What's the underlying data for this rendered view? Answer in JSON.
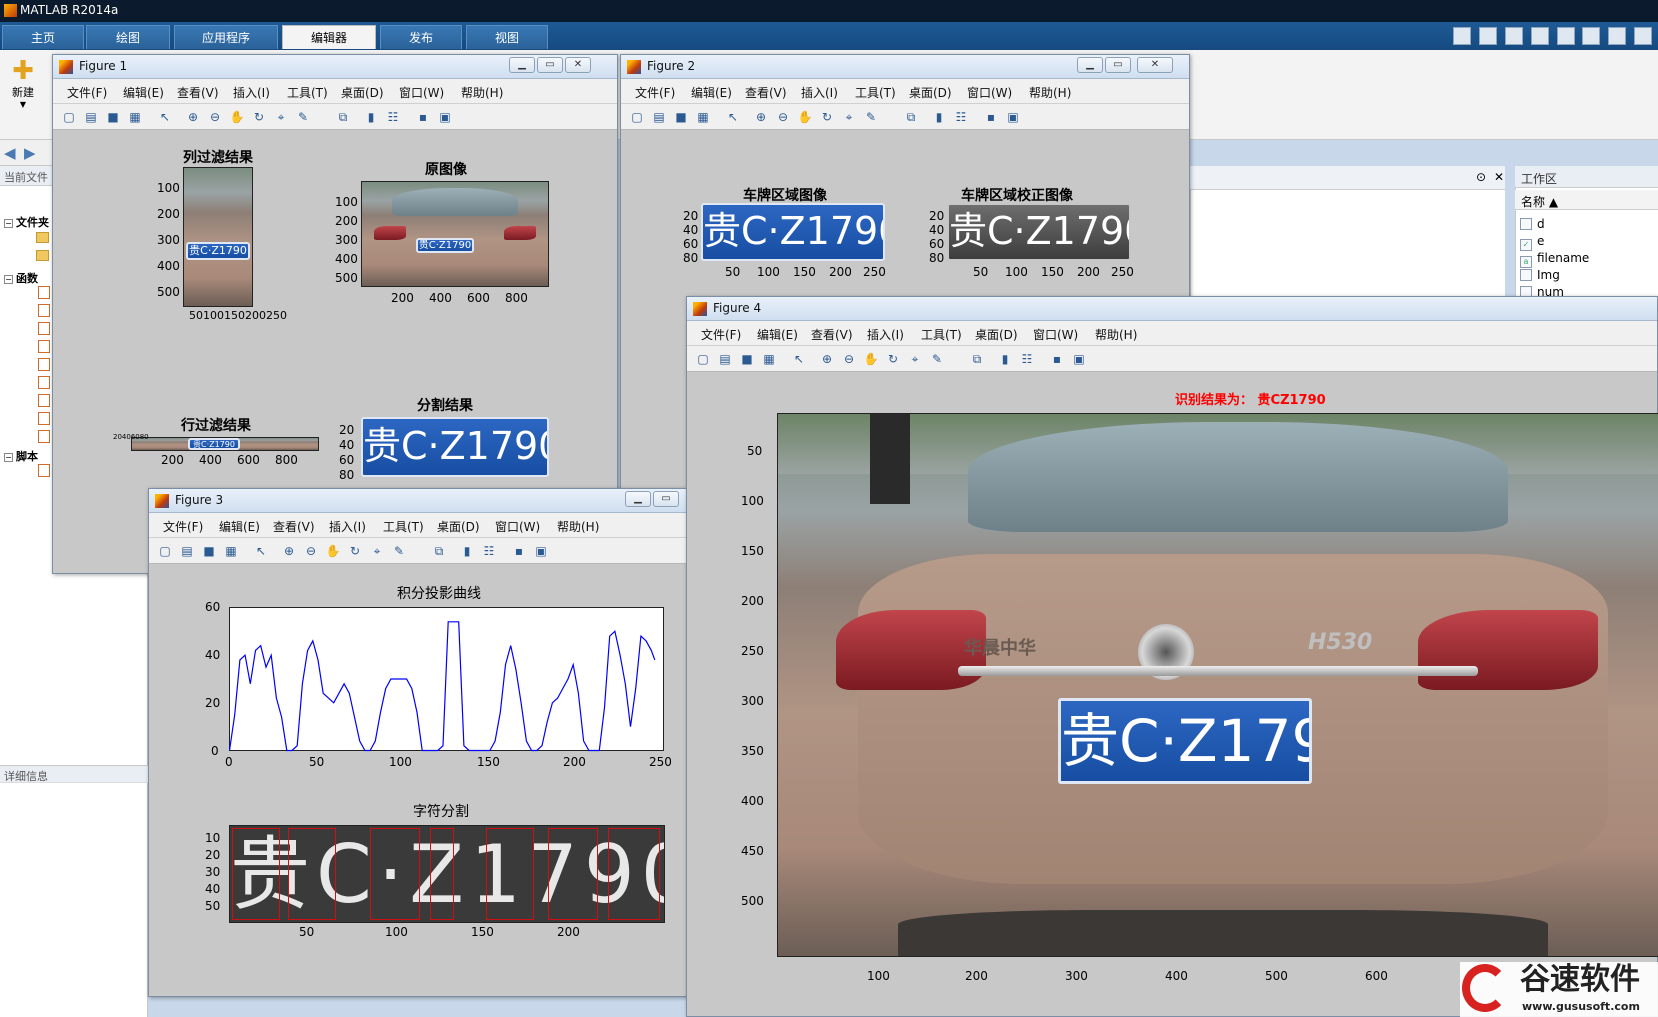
{
  "app": {
    "title": "MATLAB R2014a",
    "tabs": [
      "主页",
      "绘图",
      "应用程序",
      "编辑器",
      "发布",
      "视图"
    ],
    "active_tab": "编辑器",
    "new_label": "新建"
  },
  "left_panel": {
    "current_folder": "当前文件",
    "folder_node": "文件夹",
    "functions_node": "函数",
    "scripts_node": "脚本",
    "details": "详细信息"
  },
  "workspace": {
    "title": "工作区",
    "column": "名称 ▲",
    "vars": [
      "d",
      "e",
      "filename",
      "Img",
      "num"
    ]
  },
  "figure_menu": [
    "文件(F)",
    "编辑(E)",
    "查看(V)",
    "插入(I)",
    "工具(T)",
    "桌面(D)",
    "窗口(W)",
    "帮助(H)"
  ],
  "fig1": {
    "title": "Figure 1",
    "ax_col_title": "列过滤结果",
    "ax_col_yticks": [
      "100",
      "200",
      "300",
      "400",
      "500"
    ],
    "ax_col_xticks": "50100150200250",
    "ax_orig_title": "原图像",
    "ax_orig_yticks": [
      "100",
      "200",
      "300",
      "400",
      "500"
    ],
    "ax_orig_xticks": [
      "200",
      "400",
      "600",
      "800"
    ],
    "ax_row_title": "行过滤结果",
    "ax_row_yticks": "20406080",
    "ax_row_xticks": [
      "200",
      "400",
      "600",
      "800"
    ],
    "ax_seg_title": "分割结果",
    "ax_seg_yticks": [
      "20",
      "40",
      "60",
      "80"
    ]
  },
  "fig2": {
    "title": "Figure 2",
    "ax_plate_title": "车牌区域图像",
    "ax_corr_title": "车牌区域校正图像",
    "yticks": [
      "20",
      "40",
      "60",
      "80"
    ],
    "xticks": [
      "50",
      "100",
      "150",
      "200",
      "250"
    ]
  },
  "fig3": {
    "title": "Figure 3",
    "curve_title": "积分投影曲线",
    "curve_yticks": [
      "60",
      "40",
      "20",
      "0"
    ],
    "curve_xticks": [
      "0",
      "50",
      "100",
      "150",
      "200",
      "250"
    ],
    "seg_title": "字符分割",
    "seg_yticks": [
      "10",
      "20",
      "30",
      "40",
      "50"
    ],
    "seg_xticks": [
      "50",
      "100",
      "150",
      "200"
    ]
  },
  "fig4": {
    "title": "Figure 4",
    "result": "识别结果为： 贵CZ1790",
    "yticks": [
      "50",
      "100",
      "150",
      "200",
      "250",
      "300",
      "350",
      "400",
      "450",
      "500"
    ],
    "xticks": [
      "100",
      "200",
      "300",
      "400",
      "500",
      "600"
    ]
  },
  "plate_text": "贵C·Z1790",
  "car_brand_left": "华晨中华",
  "car_brand_right": "H530",
  "watermark": {
    "name": "谷速软件",
    "url": "www.gususoft.com"
  },
  "colors": {
    "ribbon": "#1e5a95",
    "plate_blue": "#1f5bb5",
    "curve": "#0000ff",
    "result_text": "#ff0000",
    "watermark_red": "#d7221f"
  },
  "chart_data": {
    "type": "line",
    "title": "积分投影曲线",
    "xlim": [
      0,
      250
    ],
    "ylim": [
      0,
      60
    ],
    "series": [
      {
        "values": [
          [
            0,
            0
          ],
          [
            3,
            15
          ],
          [
            6,
            38
          ],
          [
            9,
            40
          ],
          [
            12,
            28
          ],
          [
            15,
            42
          ],
          [
            18,
            44
          ],
          [
            21,
            35
          ],
          [
            24,
            40
          ],
          [
            27,
            22
          ],
          [
            30,
            14
          ],
          [
            33,
            0
          ],
          [
            36,
            0
          ],
          [
            39,
            2
          ],
          [
            42,
            28
          ],
          [
            45,
            42
          ],
          [
            48,
            46
          ],
          [
            51,
            38
          ],
          [
            54,
            24
          ],
          [
            57,
            22
          ],
          [
            60,
            20
          ],
          [
            63,
            24
          ],
          [
            66,
            28
          ],
          [
            69,
            24
          ],
          [
            72,
            14
          ],
          [
            75,
            4
          ],
          [
            78,
            0
          ],
          [
            81,
            0
          ],
          [
            84,
            4
          ],
          [
            87,
            16
          ],
          [
            90,
            26
          ],
          [
            93,
            30
          ],
          [
            96,
            30
          ],
          [
            99,
            30
          ],
          [
            102,
            30
          ],
          [
            105,
            26
          ],
          [
            108,
            16
          ],
          [
            111,
            0
          ],
          [
            114,
            0
          ],
          [
            117,
            0
          ],
          [
            120,
            0
          ],
          [
            123,
            2
          ],
          [
            126,
            54
          ],
          [
            129,
            54
          ],
          [
            132,
            54
          ],
          [
            135,
            2
          ],
          [
            138,
            0
          ],
          [
            141,
            0
          ],
          [
            144,
            0
          ],
          [
            147,
            0
          ],
          [
            150,
            0
          ],
          [
            153,
            4
          ],
          [
            156,
            16
          ],
          [
            159,
            36
          ],
          [
            162,
            44
          ],
          [
            165,
            34
          ],
          [
            168,
            20
          ],
          [
            171,
            4
          ],
          [
            174,
            0
          ],
          [
            177,
            0
          ],
          [
            180,
            2
          ],
          [
            183,
            12
          ],
          [
            186,
            20
          ],
          [
            189,
            22
          ],
          [
            192,
            26
          ],
          [
            195,
            30
          ],
          [
            198,
            36
          ],
          [
            201,
            24
          ],
          [
            204,
            4
          ],
          [
            207,
            0
          ],
          [
            210,
            0
          ],
          [
            213,
            0
          ],
          [
            216,
            18
          ],
          [
            219,
            48
          ],
          [
            222,
            50
          ],
          [
            225,
            40
          ],
          [
            228,
            28
          ],
          [
            231,
            10
          ],
          [
            234,
            26
          ],
          [
            237,
            48
          ],
          [
            240,
            46
          ],
          [
            243,
            42
          ],
          [
            245,
            38
          ]
        ]
      }
    ]
  }
}
